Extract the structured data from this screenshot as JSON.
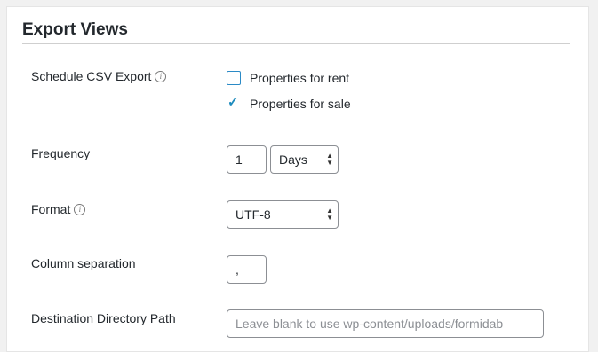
{
  "section": {
    "title": "Export Views"
  },
  "schedule": {
    "label": "Schedule CSV Export",
    "options": [
      {
        "label": "Properties for rent",
        "checked": false
      },
      {
        "label": "Properties for sale",
        "checked": true
      }
    ],
    "checkmark": "✓"
  },
  "frequency": {
    "label": "Frequency",
    "value": "1",
    "unit": "Days"
  },
  "format": {
    "label": "Format",
    "value": "UTF-8"
  },
  "column_separation": {
    "label": "Column separation",
    "value": ","
  },
  "destination": {
    "label": "Destination Directory Path",
    "placeholder": "Leave blank to use wp-content/uploads/formidab"
  },
  "icons": {
    "info": "i",
    "arrows": "▲▼"
  }
}
